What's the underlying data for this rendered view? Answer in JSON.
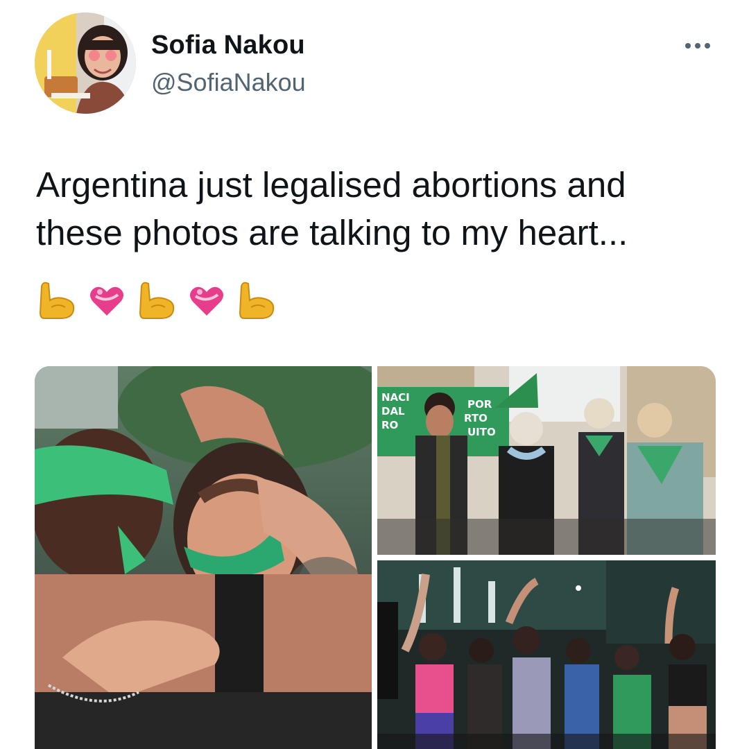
{
  "user": {
    "display_name": "Sofia Nakou",
    "handle": "@SofiaNakou"
  },
  "tweet": {
    "text_lines": [
      "Argentina just legalised abortions and",
      "these photos are talking to my heart..."
    ],
    "emojis": [
      "flexed-biceps",
      "heart-with-ribbon",
      "flexed-biceps",
      "heart-with-ribbon",
      "flexed-biceps"
    ]
  },
  "media": {
    "photos": [
      {
        "name": "hugging-women-photo"
      },
      {
        "name": "elderly-women-march-photo",
        "sign_fragments": [
          "NACI",
          "DAL",
          "RO",
          "POR",
          "RTO",
          "UITO"
        ]
      },
      {
        "name": "night-celebration-photo"
      }
    ]
  },
  "colors": {
    "text": "#0f1419",
    "secondary": "#536471",
    "campaign_green": "#3aa86b"
  }
}
